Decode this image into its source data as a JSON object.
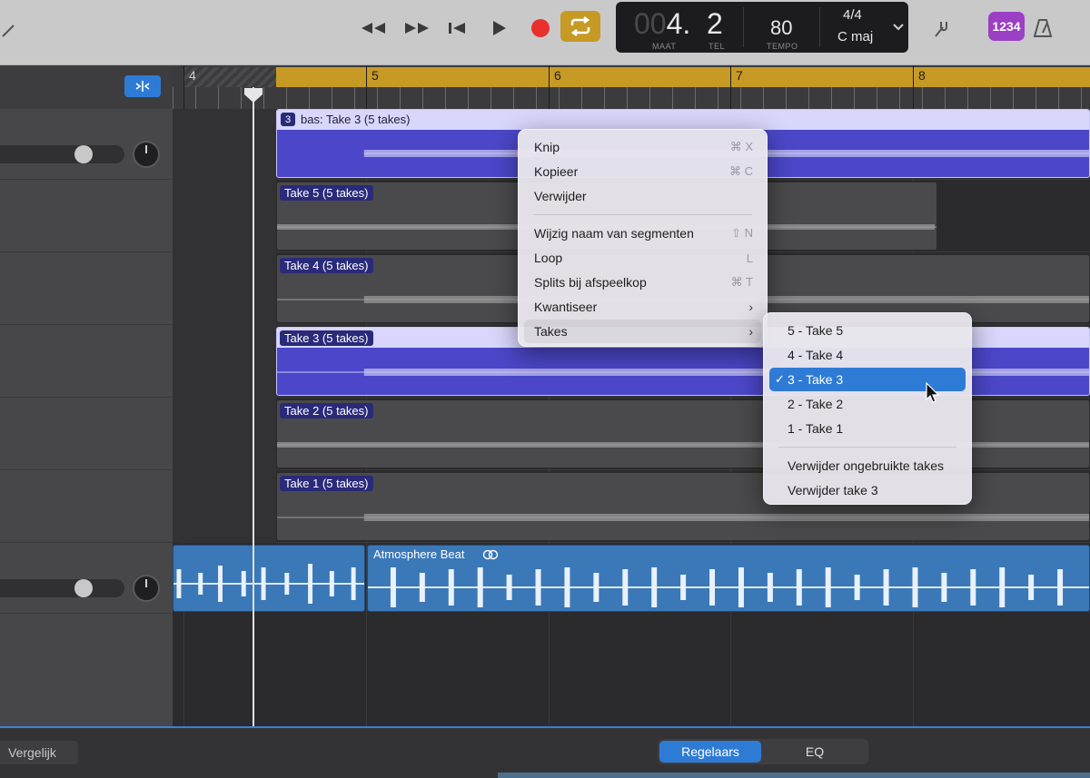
{
  "transport": {
    "lcd": {
      "maat_dim": "00",
      "maat": "4.",
      "tel": "2",
      "maat_label": "MAAT",
      "tel_label": "TEL",
      "tempo": "80",
      "tempo_label": "TEMPO",
      "signature": "4/4",
      "key": "C maj"
    },
    "count_in": "1234"
  },
  "ruler": {
    "bars": [
      "4",
      "5",
      "6",
      "7",
      "8"
    ]
  },
  "tracks": {
    "bass_comp_label": "bas: Take 3 (5 takes)",
    "bass_comp_badge": "3",
    "takes": [
      "Take 5 (5 takes)",
      "Take 4 (5 takes)",
      "Take 3 (5 takes)",
      "Take 2 (5 takes)",
      "Take 1 (5 takes)"
    ],
    "beat_label": "Atmosphere Beat"
  },
  "context_menu": {
    "items": [
      {
        "label": "Knip",
        "shortcut": "⌘ X"
      },
      {
        "label": "Kopieer",
        "shortcut": "⌘ C"
      },
      {
        "label": "Verwijder",
        "shortcut": ""
      },
      {
        "label": "Wijzig naam van segmenten",
        "shortcut": "⇧ N"
      },
      {
        "label": "Loop",
        "shortcut": "L"
      },
      {
        "label": "Splits bij afspeelkop",
        "shortcut": "⌘ T"
      },
      {
        "label": "Kwantiseer",
        "shortcut": ""
      },
      {
        "label": "Takes",
        "shortcut": ""
      }
    ]
  },
  "takes_menu": {
    "items": [
      "5 - Take 5",
      "4 - Take 4",
      "3 - Take 3",
      "2 - Take 2",
      "1 - Take 1"
    ],
    "selected_check": "✓",
    "actions": [
      "Verwijder ongebruikte takes",
      "Verwijder take 3"
    ]
  },
  "bottom": {
    "vergelijk": "Vergelijk",
    "tab_regelaars": "Regelaars",
    "tab_eq": "EQ"
  },
  "colors": {
    "accent": "#2e7bd6",
    "cycle": "#c69a25",
    "take_selected": "#4b47c8",
    "take_label": "#2a2a7a",
    "beat": "#3a78b8"
  }
}
